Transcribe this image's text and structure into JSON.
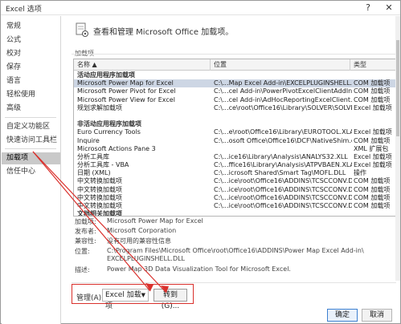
{
  "window": {
    "title": "Excel 选项",
    "help_glyph": "?",
    "close_glyph": "✕"
  },
  "sidebar": {
    "items": [
      {
        "label": "常规"
      },
      {
        "label": "公式"
      },
      {
        "label": "校对"
      },
      {
        "label": "保存"
      },
      {
        "label": "语言"
      },
      {
        "label": "轻松使用"
      },
      {
        "label": "高级"
      },
      {
        "label": "自定义功能区"
      },
      {
        "label": "快速访问工具栏"
      },
      {
        "label": "加载项"
      },
      {
        "label": "信任中心"
      }
    ],
    "active_index": 9
  },
  "header": {
    "text": "查看和管理 Microsoft Office 加载项。"
  },
  "addins": {
    "section_label": "加载项",
    "columns": {
      "name": "名称 ▲",
      "location": "位置",
      "type": "类型"
    },
    "rows": [
      {
        "kind": "group",
        "name": "活动应用程序加载项",
        "location": "",
        "type": ""
      },
      {
        "kind": "item",
        "selected": true,
        "name": "Microsoft Power Map for Excel",
        "location": "C:\\...Map Excel Add-in\\EXCELPLUGINSHELL.DLL",
        "type": "COM 加载项"
      },
      {
        "kind": "item",
        "name": "Microsoft Power Pivot for Excel",
        "location": "C:\\...cel Add-in\\PowerPivotExcelClientAddIn.dll",
        "type": "COM 加载项"
      },
      {
        "kind": "item",
        "name": "Microsoft Power View for Excel",
        "location": "C:\\...cel Add-in\\AdHocReportingExcelClient.dll",
        "type": "COM 加载项"
      },
      {
        "kind": "item",
        "name": "规划求解加载项",
        "location": "C:\\...ce\\root\\Office16\\Library\\SOLVER\\SOLVER.XLAM",
        "type": "Excel 加载项"
      },
      {
        "kind": "spacer",
        "name": "",
        "location": "",
        "type": ""
      },
      {
        "kind": "group",
        "name": "非活动应用程序加载项",
        "location": "",
        "type": ""
      },
      {
        "kind": "item",
        "name": "Euro Currency Tools",
        "location": "C:\\...e\\root\\Office16\\Library\\EUROTOOL.XLAM",
        "type": "Excel 加载项"
      },
      {
        "kind": "item",
        "name": "Inquire",
        "location": "C:\\...osoft Office\\Office16\\DCF\\NativeShim.dll",
        "type": "COM 加载项"
      },
      {
        "kind": "item",
        "name": "Microsoft Actions Pane 3",
        "location": "",
        "type": "XML 扩展包"
      },
      {
        "kind": "item",
        "name": "分析工具库",
        "location": "C:\\...ice16\\Library\\Analysis\\ANALYS32.XLL",
        "type": "Excel 加载项"
      },
      {
        "kind": "item",
        "name": "分析工具库 - VBA",
        "location": "C:\\...ffice16\\Library\\Analysis\\ATPVBAEN.XLAM",
        "type": "Excel 加载项"
      },
      {
        "kind": "item",
        "name": "日期 (XML)",
        "location": "C:\\...icrosoft Shared\\Smart Tag\\MOFL.DLL",
        "type": "操作"
      },
      {
        "kind": "item",
        "name": "中文转换加载项",
        "location": "C:\\...ice\\root\\Office16\\ADDINS\\TCSCCONV.DLL",
        "type": "COM 加载项"
      },
      {
        "kind": "item",
        "name": "中文转换加载项",
        "location": "C:\\...ice\\root\\Office16\\ADDINS\\TCSCCONV.DLL",
        "type": "COM 加载项"
      },
      {
        "kind": "item",
        "name": "中文转换加载项",
        "location": "C:\\...ice\\root\\Office16\\ADDINS\\TCSCCONV.DLL",
        "type": "COM 加载项"
      },
      {
        "kind": "item",
        "name": "中文转换加载项",
        "location": "C:\\...ice\\root\\Office16\\ADDINS\\TCSCCONV.DLL",
        "type": "COM 加载项"
      },
      {
        "kind": "group",
        "name": "文档相关加载项",
        "location": "",
        "type": ""
      }
    ]
  },
  "details": {
    "addin_label": "加载项:",
    "addin_value": "Microsoft Power Map for Excel",
    "publisher_label": "发布者:",
    "publisher_value": "Microsoft Corporation",
    "compat_label": "兼容性:",
    "compat_value": "没有可用的兼容性信息",
    "location_label": "位置:",
    "location_value_1": "C:\\Program Files\\Microsoft Office\\root\\Office16\\ADDINS\\Power Map Excel Add-in\\",
    "location_value_2": "EXCELPLUGINSHELL.DLL",
    "desc_label": "描述:",
    "desc_value": "Power Map 3D Data Visualization Tool for Microsoft Excel."
  },
  "manage": {
    "label": "管理(A):",
    "selected": "Excel 加载项",
    "go_label": "转到(G)..."
  },
  "buttons": {
    "ok": "确定",
    "cancel": "取消"
  },
  "colors": {
    "annotation_red": "#d9302c",
    "selection": "#cdd6e4",
    "sidebar_active": "#c9c9c9"
  }
}
